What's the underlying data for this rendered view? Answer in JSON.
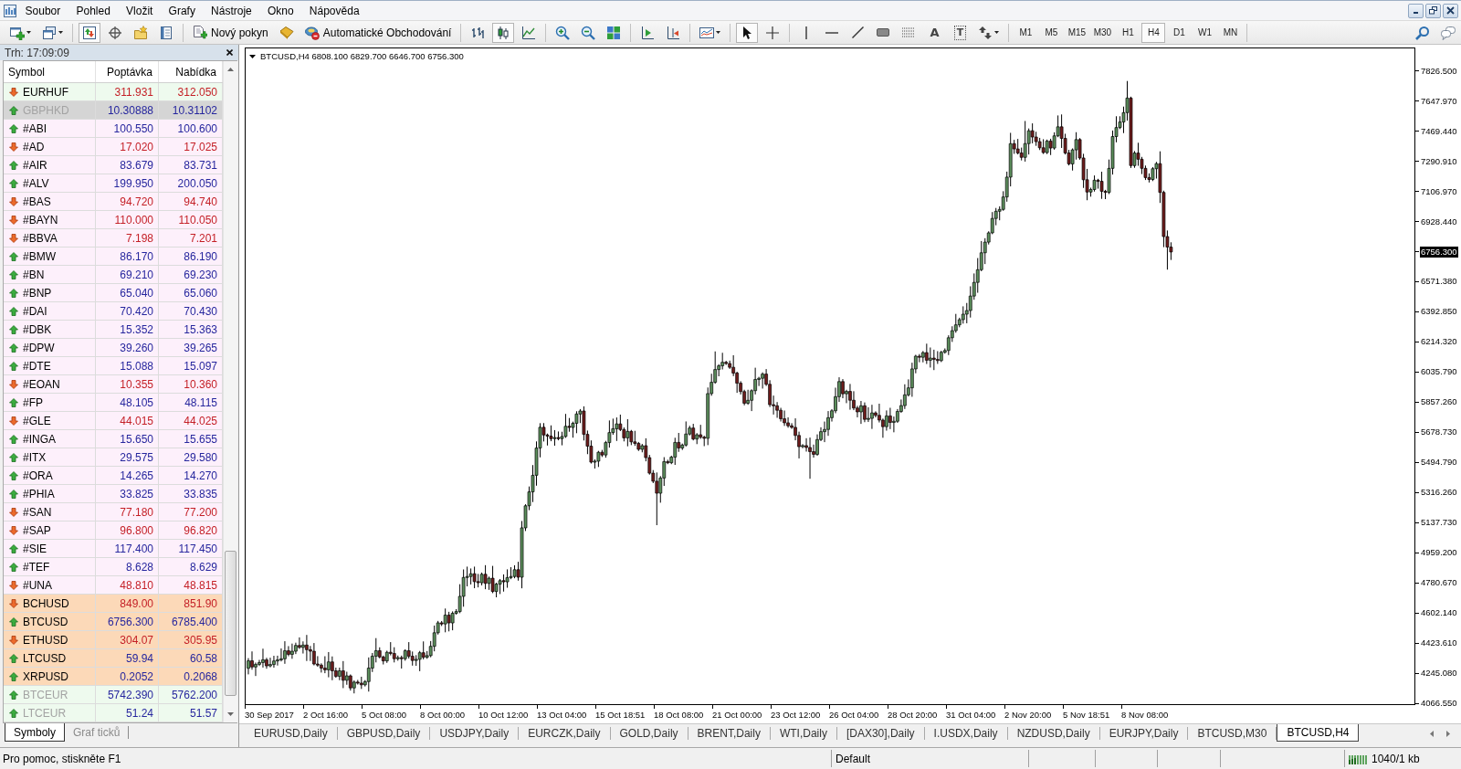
{
  "menu_bar": {
    "items": [
      "Soubor",
      "Pohled",
      "Vložit",
      "Grafy",
      "Nástroje",
      "Okno",
      "Nápověda"
    ]
  },
  "toolbar": {
    "groups": [
      [
        {
          "kind": "newchart",
          "pressed": false
        },
        {
          "kind": "profiles",
          "pressed": false
        }
      ],
      [
        {
          "kind": "marketwatch",
          "pressed": true
        },
        {
          "kind": "datawindow",
          "pressed": false
        },
        {
          "kind": "navigator",
          "pressed": false
        },
        {
          "kind": "terminal",
          "pressed": false
        }
      ],
      [
        {
          "kind": "neworder",
          "label": "Nový pokyn",
          "pressed": false
        },
        {
          "kind": "editor",
          "pressed": false
        },
        {
          "kind": "autotrading",
          "label": "Automatické Obchodování",
          "pressed": false
        }
      ],
      [
        {
          "kind": "barchart",
          "pressed": false
        },
        {
          "kind": "candles",
          "pressed": true
        },
        {
          "kind": "linechart",
          "pressed": false
        }
      ],
      [
        {
          "kind": "zoomin",
          "pressed": false
        },
        {
          "kind": "zoomout",
          "pressed": false
        },
        {
          "kind": "tile",
          "pressed": false
        }
      ],
      [
        {
          "kind": "shift",
          "pressed": false
        },
        {
          "kind": "autoscroll",
          "pressed": false
        }
      ],
      [
        {
          "kind": "indicators",
          "pressed": false
        }
      ],
      [
        {
          "kind": "cursor",
          "pressed": true
        },
        {
          "kind": "crosshair",
          "pressed": false
        }
      ],
      [
        {
          "kind": "vline",
          "pressed": false
        },
        {
          "kind": "hline",
          "pressed": false
        },
        {
          "kind": "trendline",
          "pressed": false
        },
        {
          "kind": "rectangle",
          "pressed": false
        },
        {
          "kind": "fibo",
          "pressed": false
        },
        {
          "kind": "text",
          "glyph": "A",
          "pressed": false
        },
        {
          "kind": "label",
          "glyph": "T",
          "pressed": false
        },
        {
          "kind": "arrows",
          "pressed": false
        }
      ]
    ],
    "timeframes": [
      {
        "label": "M1",
        "selected": false
      },
      {
        "label": "M5",
        "selected": false
      },
      {
        "label": "M15",
        "selected": false
      },
      {
        "label": "M30",
        "selected": false
      },
      {
        "label": "H1",
        "selected": false
      },
      {
        "label": "H4",
        "selected": true
      },
      {
        "label": "D1",
        "selected": false
      },
      {
        "label": "W1",
        "selected": false
      },
      {
        "label": "MN",
        "selected": false
      }
    ],
    "right_tools": [
      {
        "kind": "search",
        "pressed": false
      },
      {
        "kind": "community",
        "pressed": false
      }
    ]
  },
  "market_watch": {
    "title": "Trh: 17:09:09",
    "columns": [
      "Symbol",
      "Poptávka",
      "Nabídka"
    ],
    "rows": [
      {
        "symbol": "EURHUF",
        "bid": "311.931",
        "ask": "312.050",
        "rising": false,
        "color": "#eefaee",
        "selected": false,
        "disabled": false
      },
      {
        "symbol": "GBPHKD",
        "bid": "10.30888",
        "ask": "10.31102",
        "rising": true,
        "selected": true,
        "disabled": true
      },
      {
        "symbol": "#ABI",
        "bid": "100.550",
        "ask": "100.600",
        "rising": true,
        "color": "#fdf0fb",
        "selected": false,
        "disabled": false
      },
      {
        "symbol": "#AD",
        "bid": "17.020",
        "ask": "17.025",
        "rising": false,
        "color": "#fdf0fb",
        "selected": false,
        "disabled": false
      },
      {
        "symbol": "#AIR",
        "bid": "83.679",
        "ask": "83.731",
        "rising": true,
        "color": "#fdf0fb",
        "selected": false,
        "disabled": false
      },
      {
        "symbol": "#ALV",
        "bid": "199.950",
        "ask": "200.050",
        "rising": true,
        "color": "#fdf0fb",
        "selected": false,
        "disabled": false
      },
      {
        "symbol": "#BAS",
        "bid": "94.720",
        "ask": "94.740",
        "rising": false,
        "color": "#fdf0fb",
        "selected": false,
        "disabled": false
      },
      {
        "symbol": "#BAYN",
        "bid": "110.000",
        "ask": "110.050",
        "rising": false,
        "color": "#fdf0fb",
        "selected": false,
        "disabled": false
      },
      {
        "symbol": "#BBVA",
        "bid": "7.198",
        "ask": "7.201",
        "rising": false,
        "color": "#fdf0fb",
        "selected": false,
        "disabled": false
      },
      {
        "symbol": "#BMW",
        "bid": "86.170",
        "ask": "86.190",
        "rising": true,
        "color": "#fdf0fb",
        "selected": false,
        "disabled": false
      },
      {
        "symbol": "#BN",
        "bid": "69.210",
        "ask": "69.230",
        "rising": true,
        "color": "#fdf0fb",
        "selected": false,
        "disabled": false
      },
      {
        "symbol": "#BNP",
        "bid": "65.040",
        "ask": "65.060",
        "rising": true,
        "color": "#fdf0fb",
        "selected": false,
        "disabled": false
      },
      {
        "symbol": "#DAI",
        "bid": "70.420",
        "ask": "70.430",
        "rising": true,
        "color": "#fdf0fb",
        "selected": false,
        "disabled": false
      },
      {
        "symbol": "#DBK",
        "bid": "15.352",
        "ask": "15.363",
        "rising": true,
        "color": "#fdf0fb",
        "selected": false,
        "disabled": false
      },
      {
        "symbol": "#DPW",
        "bid": "39.260",
        "ask": "39.265",
        "rising": true,
        "color": "#fdf0fb",
        "selected": false,
        "disabled": false
      },
      {
        "symbol": "#DTE",
        "bid": "15.088",
        "ask": "15.097",
        "rising": true,
        "color": "#fdf0fb",
        "selected": false,
        "disabled": false
      },
      {
        "symbol": "#EOAN",
        "bid": "10.355",
        "ask": "10.360",
        "rising": false,
        "color": "#fdf0fb",
        "selected": false,
        "disabled": false
      },
      {
        "symbol": "#FP",
        "bid": "48.105",
        "ask": "48.115",
        "rising": true,
        "color": "#fdf0fb",
        "selected": false,
        "disabled": false
      },
      {
        "symbol": "#GLE",
        "bid": "44.015",
        "ask": "44.025",
        "rising": false,
        "color": "#fdf0fb",
        "selected": false,
        "disabled": false
      },
      {
        "symbol": "#INGA",
        "bid": "15.650",
        "ask": "15.655",
        "rising": true,
        "color": "#fdf0fb",
        "selected": false,
        "disabled": false
      },
      {
        "symbol": "#ITX",
        "bid": "29.575",
        "ask": "29.580",
        "rising": true,
        "color": "#fdf0fb",
        "selected": false,
        "disabled": false
      },
      {
        "symbol": "#ORA",
        "bid": "14.265",
        "ask": "14.270",
        "rising": true,
        "color": "#fdf0fb",
        "selected": false,
        "disabled": false
      },
      {
        "symbol": "#PHIA",
        "bid": "33.825",
        "ask": "33.835",
        "rising": true,
        "color": "#fdf0fb",
        "selected": false,
        "disabled": false
      },
      {
        "symbol": "#SAN",
        "bid": "77.180",
        "ask": "77.200",
        "rising": false,
        "color": "#fdf0fb",
        "selected": false,
        "disabled": false
      },
      {
        "symbol": "#SAP",
        "bid": "96.800",
        "ask": "96.820",
        "rising": false,
        "color": "#fdf0fb",
        "selected": false,
        "disabled": false
      },
      {
        "symbol": "#SIE",
        "bid": "117.400",
        "ask": "117.450",
        "rising": true,
        "color": "#fdf0fb",
        "selected": false,
        "disabled": false
      },
      {
        "symbol": "#TEF",
        "bid": "8.628",
        "ask": "8.629",
        "rising": true,
        "color": "#fdf0fb",
        "selected": false,
        "disabled": false
      },
      {
        "symbol": "#UNA",
        "bid": "48.810",
        "ask": "48.815",
        "rising": false,
        "color": "#fdf0fb",
        "selected": false,
        "disabled": false
      },
      {
        "symbol": "BCHUSD",
        "bid": "849.00",
        "ask": "851.90",
        "rising": false,
        "color": "#fcd9b8",
        "selected": false,
        "disabled": false
      },
      {
        "symbol": "BTCUSD",
        "bid": "6756.300",
        "ask": "6785.400",
        "rising": true,
        "color": "#fcd9b8",
        "selected": false,
        "disabled": false
      },
      {
        "symbol": "ETHUSD",
        "bid": "304.07",
        "ask": "305.95",
        "rising": false,
        "color": "#fcd9b8",
        "selected": false,
        "disabled": false
      },
      {
        "symbol": "LTCUSD",
        "bid": "59.94",
        "ask": "60.58",
        "rising": true,
        "color": "#fcd9b8",
        "selected": false,
        "disabled": false
      },
      {
        "symbol": "XRPUSD",
        "bid": "0.2052",
        "ask": "0.2068",
        "rising": true,
        "color": "#fcd9b8",
        "selected": false,
        "disabled": false
      },
      {
        "symbol": "BTCEUR",
        "bid": "5742.390",
        "ask": "5762.200",
        "rising": true,
        "color": "#eefaee",
        "selected": false,
        "disabled": true
      },
      {
        "symbol": "LTCEUR",
        "bid": "51.24",
        "ask": "51.57",
        "rising": true,
        "color": "#eefaee",
        "selected": false,
        "disabled": true
      }
    ],
    "tabs": [
      {
        "label": "Symboly",
        "selected": true
      },
      {
        "label": "Graf ticků",
        "selected": false
      }
    ]
  },
  "chart": {
    "header": "BTCUSD,H4 6808.100 6829.700 6646.700 6756.300",
    "price_labels": [
      {
        "text": "7826.500",
        "current": false
      },
      {
        "text": "7647.970",
        "current": false
      },
      {
        "text": "7469.440",
        "current": false
      },
      {
        "text": "7290.910",
        "current": false
      },
      {
        "text": "7106.970",
        "current": false
      },
      {
        "text": "6928.440",
        "current": false
      },
      {
        "text": "6756.300",
        "current": true
      },
      {
        "text": "6571.380",
        "current": false
      },
      {
        "text": "6392.850",
        "current": false
      },
      {
        "text": "6214.320",
        "current": false
      },
      {
        "text": "6035.790",
        "current": false
      },
      {
        "text": "5857.260",
        "current": false
      },
      {
        "text": "5678.730",
        "current": false
      },
      {
        "text": "5494.790",
        "current": false
      },
      {
        "text": "5316.260",
        "current": false
      },
      {
        "text": "5137.730",
        "current": false
      },
      {
        "text": "4959.200",
        "current": false
      },
      {
        "text": "4780.670",
        "current": false
      },
      {
        "text": "4602.140",
        "current": false
      },
      {
        "text": "4423.610",
        "current": false
      },
      {
        "text": "4245.080",
        "current": false
      },
      {
        "text": "4066.550",
        "current": false
      }
    ],
    "time_labels": [
      "30 Sep 2017",
      "2 Oct 16:00",
      "5 Oct 08:00",
      "8 Oct 00:00",
      "10 Oct 12:00",
      "13 Oct 04:00",
      "15 Oct 18:51",
      "18 Oct 08:00",
      "21 Oct 00:00",
      "23 Oct 12:00",
      "26 Oct 04:00",
      "28 Oct 20:00",
      "31 Oct 04:00",
      "2 Nov 20:00",
      "5 Nov 18:51",
      "8 Nov 08:00"
    ]
  },
  "chart_tabs": [
    {
      "label": "EURUSD,Daily",
      "selected": false
    },
    {
      "label": "GBPUSD,Daily",
      "selected": false
    },
    {
      "label": "USDJPY,Daily",
      "selected": false
    },
    {
      "label": "EURCZK,Daily",
      "selected": false
    },
    {
      "label": "GOLD,Daily",
      "selected": false
    },
    {
      "label": "BRENT,Daily",
      "selected": false
    },
    {
      "label": "WTI,Daily",
      "selected": false
    },
    {
      "label": "[DAX30],Daily",
      "selected": false
    },
    {
      "label": "I.USDX,Daily",
      "selected": false
    },
    {
      "label": "NZDUSD,Daily",
      "selected": false
    },
    {
      "label": "EURJPY,Daily",
      "selected": false
    },
    {
      "label": "BTCUSD,M30",
      "selected": false
    },
    {
      "label": "BTCUSD,H4",
      "selected": true
    }
  ],
  "status_bar": {
    "help_text": "Pro pomoc, stiskněte F1",
    "profile": "Default",
    "traffic": "1040/1 kb"
  }
}
